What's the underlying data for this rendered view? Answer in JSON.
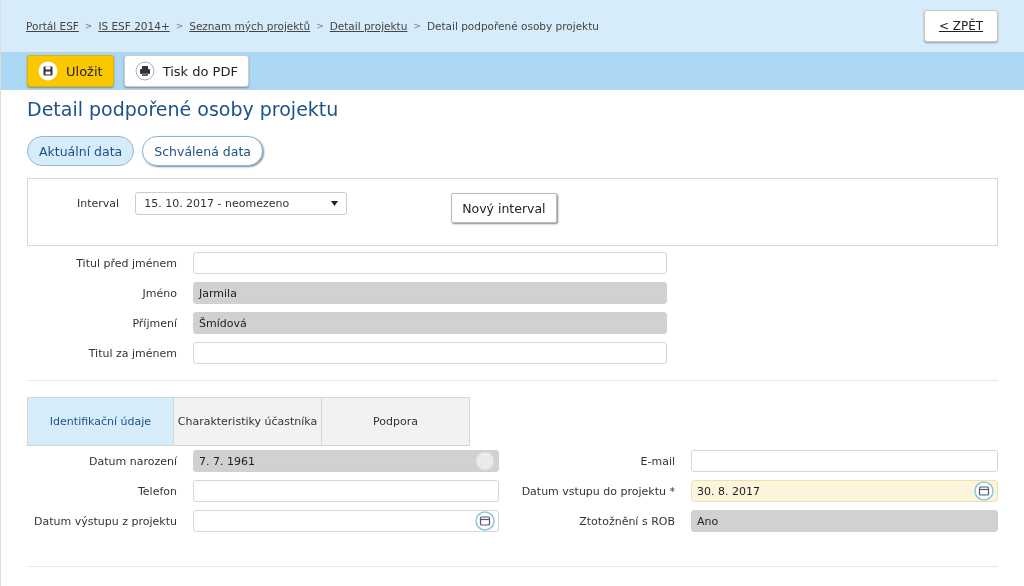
{
  "breadcrumb": [
    {
      "label": "Portál ESF",
      "link": true
    },
    {
      "label": "IS ESF 2014+",
      "link": true
    },
    {
      "label": "Seznam mých projektů",
      "link": true
    },
    {
      "label": "Detail projektu",
      "link": true
    },
    {
      "label": "Detail podpořené osoby projektu",
      "link": false
    }
  ],
  "breadcrumb_separator": ">",
  "back_button": "< ZPĚT",
  "toolbar": [
    {
      "kind": "save",
      "label": "Uložit"
    },
    {
      "kind": "print",
      "label": "Tisk do PDF"
    }
  ],
  "title": "Detail podpořené osoby projektu",
  "data_tabs": [
    {
      "label": "Aktuální data",
      "selected": true
    },
    {
      "label": "Schválená data",
      "selected": false
    }
  ],
  "interval": {
    "label": "Interval",
    "value": "15. 10. 2017 - neomezeno",
    "button": "Nový interval"
  },
  "person_fields": [
    {
      "label": "Titul před jménem",
      "disabled": false
    },
    {
      "label": "Jméno",
      "value": "Jarmila",
      "disabled": true
    },
    {
      "label": "Příjmení",
      "value": "Šmídová",
      "disabled": true
    },
    {
      "label": "Titul za jménem",
      "disabled": false
    }
  ],
  "section_tabs": [
    {
      "label": "Identifikační údaje",
      "selected": true
    },
    {
      "label": "Charakteristiky účastníka",
      "selected": false
    },
    {
      "label": "Podpora",
      "selected": false
    }
  ],
  "left_fields": [
    {
      "label": "Datum narození",
      "value": "7. 7. 1961",
      "disabled": true,
      "calendar": true,
      "required": false
    },
    {
      "label": "Telefon",
      "disabled": false,
      "calendar": false,
      "required": false
    },
    {
      "label": "Datum výstupu z projektu",
      "disabled": false,
      "calendar": true,
      "required": false
    }
  ],
  "right_fields": [
    {
      "label": "E-mail",
      "disabled": false,
      "calendar": false,
      "required": false
    },
    {
      "label": "Datum vstupu do projektu *",
      "value": "30. 8. 2017",
      "disabled": false,
      "calendar": true,
      "required": true
    },
    {
      "label": "Ztotožnění s ROB",
      "value": "Ano",
      "disabled": true,
      "calendar": false,
      "required": false
    }
  ]
}
